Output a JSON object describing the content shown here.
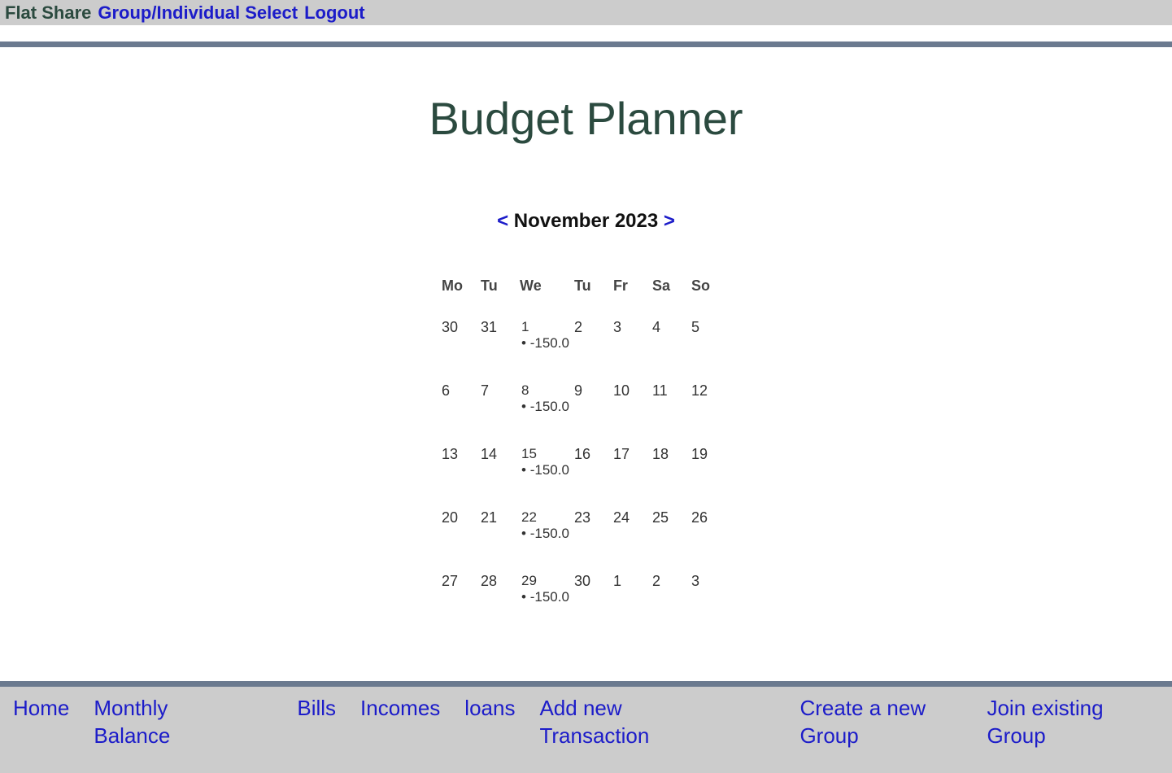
{
  "topnav": {
    "brand": "Flat Share",
    "links": [
      {
        "label": "Group/Individual Select"
      },
      {
        "label": "Logout"
      }
    ]
  },
  "page": {
    "title": "Budget Planner"
  },
  "calendar": {
    "prev": "<",
    "next": ">",
    "month_label": "November 2023",
    "weekdays": [
      "Mo",
      "Tu",
      "We",
      "Tu",
      "Fr",
      "Sa",
      "So"
    ],
    "weeks": [
      [
        {
          "day": "30"
        },
        {
          "day": "31"
        },
        {
          "day": "1",
          "entry": "-150.0"
        },
        {
          "day": "2"
        },
        {
          "day": "3"
        },
        {
          "day": "4"
        },
        {
          "day": "5"
        }
      ],
      [
        {
          "day": "6"
        },
        {
          "day": "7"
        },
        {
          "day": "8",
          "entry": "-150.0"
        },
        {
          "day": "9"
        },
        {
          "day": "10"
        },
        {
          "day": "11"
        },
        {
          "day": "12"
        }
      ],
      [
        {
          "day": "13"
        },
        {
          "day": "14"
        },
        {
          "day": "15",
          "entry": "-150.0"
        },
        {
          "day": "16"
        },
        {
          "day": "17"
        },
        {
          "day": "18"
        },
        {
          "day": "19"
        }
      ],
      [
        {
          "day": "20"
        },
        {
          "day": "21"
        },
        {
          "day": "22",
          "entry": "-150.0"
        },
        {
          "day": "23"
        },
        {
          "day": "24"
        },
        {
          "day": "25"
        },
        {
          "day": "26"
        }
      ],
      [
        {
          "day": "27"
        },
        {
          "day": "28"
        },
        {
          "day": "29",
          "entry": "-150.0"
        },
        {
          "day": "30"
        },
        {
          "day": "1"
        },
        {
          "day": "2"
        },
        {
          "day": "3"
        }
      ]
    ]
  },
  "bottomnav": {
    "links": [
      {
        "label": "Home"
      },
      {
        "label": "Monthly Balance"
      },
      {
        "label": "Bills"
      },
      {
        "label": "Incomes"
      },
      {
        "label": "loans"
      },
      {
        "label": "Add new Transaction"
      },
      {
        "label": "Create a new Group"
      },
      {
        "label": "Join existing Group"
      }
    ]
  }
}
